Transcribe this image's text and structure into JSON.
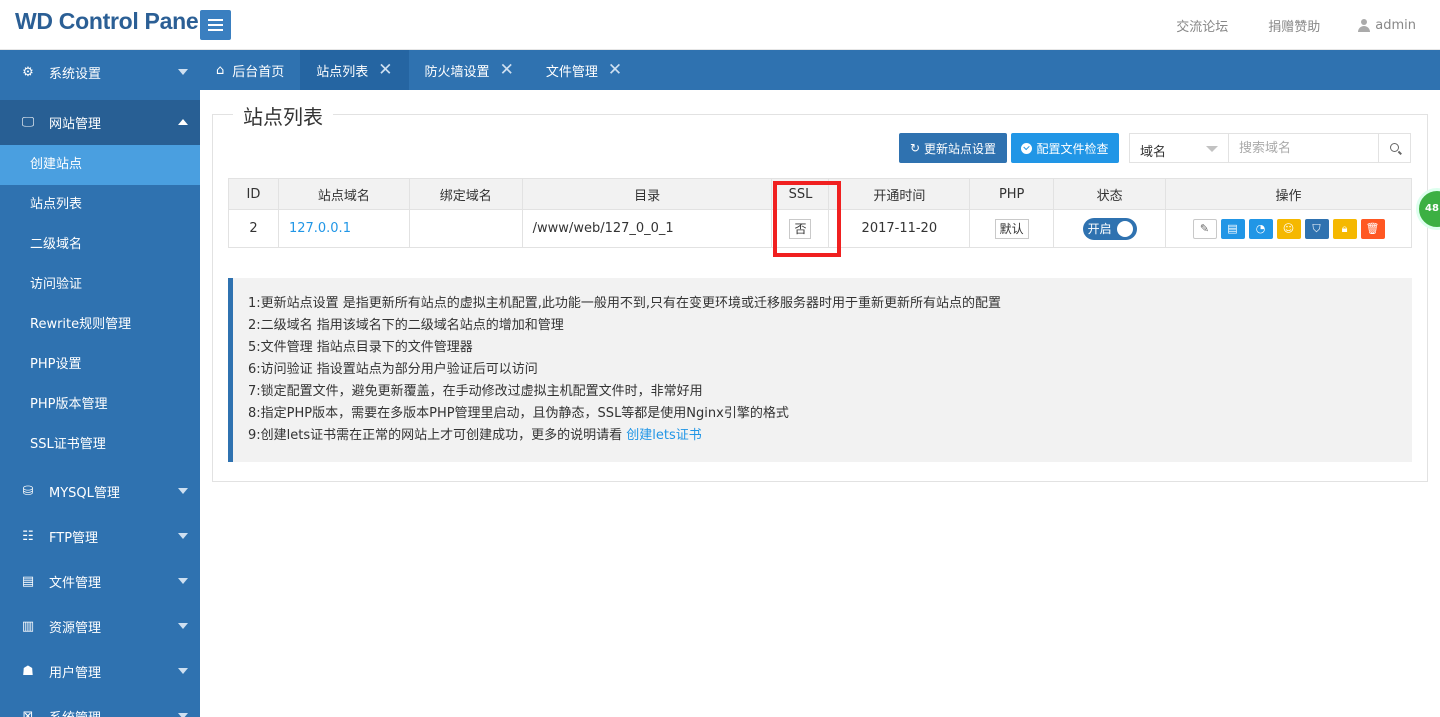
{
  "header": {
    "logo": "WD Control Panel",
    "links": [
      "交流论坛",
      "捐赠赞助"
    ],
    "user": "admin"
  },
  "sidebar": {
    "groups": [
      {
        "label": "系统设置",
        "icon": "gear-icon",
        "open": false
      },
      {
        "label": "网站管理",
        "icon": "monitor-icon",
        "open": true
      },
      {
        "label": "MYSQL管理",
        "icon": "database-icon",
        "open": false
      },
      {
        "label": "FTP管理",
        "icon": "ftp-icon",
        "open": false
      },
      {
        "label": "文件管理",
        "icon": "file-icon",
        "open": false
      },
      {
        "label": "资源管理",
        "icon": "server-icon",
        "open": false
      },
      {
        "label": "用户管理",
        "icon": "user-icon",
        "open": false
      },
      {
        "label": "系统管理",
        "icon": "system-icon",
        "open": false
      }
    ],
    "website_items": [
      "创建站点",
      "站点列表",
      "二级域名",
      "访问验证",
      "Rewrite规则管理",
      "PHP设置",
      "PHP版本管理",
      "SSL证书管理"
    ]
  },
  "tabs": [
    "后台首页",
    "站点列表",
    "防火墙设置",
    "文件管理"
  ],
  "main": {
    "title": "站点列表",
    "btn_update": "更新站点设置",
    "btn_check": "配置文件检查",
    "select_value": "域名",
    "search_placeholder": "搜索域名",
    "table": {
      "headers": [
        "ID",
        "站点域名",
        "绑定域名",
        "目录",
        "SSL",
        "开通时间",
        "PHP",
        "状态",
        "操作"
      ],
      "rows": [
        {
          "id": "2",
          "domain": "127.0.0.1",
          "bind": "",
          "dir": "/www/web/127_0_0_1",
          "ssl": "否",
          "date": "2017-11-20",
          "php": "默认",
          "status": "开启"
        }
      ]
    },
    "notes": [
      "1:更新站点设置 是指更新所有站点的虚拟主机配置,此功能一般用不到,只有在变更环境或迁移服务器时用于重新更新所有站点的配置",
      "2:二级域名 指用该域名下的二级域名站点的增加和管理",
      "5:文件管理 指站点目录下的文件管理器",
      "6:访问验证 指设置站点为部分用户验证后可以访问",
      "7:锁定配置文件，避免更新覆盖，在手动修改过虚拟主机配置文件时，非常好用",
      "8:指定PHP版本，需要在多版本PHP管理里启动，且伪静态，SSL等都是使用Nginx引擎的格式",
      "9:创建lets证书需在正常的网站上才可创建成功，更多的说明请看 "
    ],
    "notes_link": "创建lets证书",
    "badge": "48"
  }
}
